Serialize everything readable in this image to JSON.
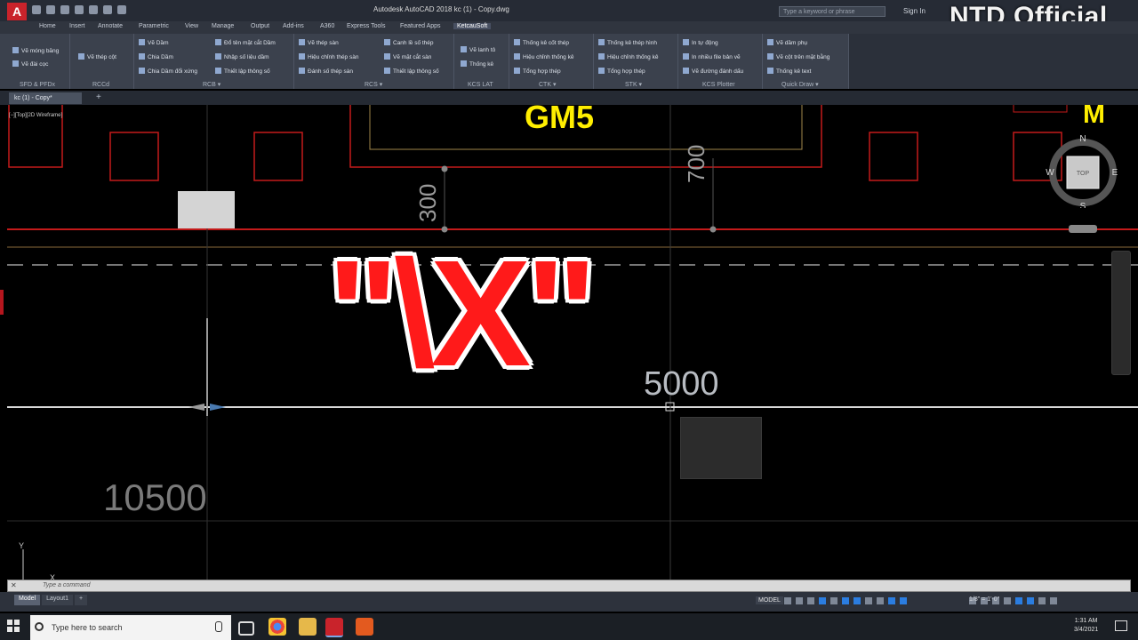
{
  "titlebar": {
    "app_letter": "A",
    "window_title": "Autodesk AutoCAD 2018    kc (1) - Copy.dwg",
    "search_placeholder": "Type a keyword or phrase",
    "signin": "Sign In",
    "watermark": "NTD Official"
  },
  "ribbon_tabs": [
    "Home",
    "Insert",
    "Annotate",
    "Parametric",
    "View",
    "Manage",
    "Output",
    "Add-ins",
    "A360",
    "Express Tools",
    "Featured Apps",
    "KetcauSoft"
  ],
  "ribbon_active_tab": "KetcauSoft",
  "ribbon": {
    "panels": [
      {
        "label": "SFD & PFDx",
        "items": [
          "Vẽ móng băng",
          "Vẽ đài cọc"
        ]
      },
      {
        "label": "RCCd",
        "items": [
          "Vẽ thép cột"
        ]
      },
      {
        "label": "RCB ▾",
        "items": [
          "Vẽ Dầm",
          "Chia Dầm",
          "Chia Dầm đổi xứng",
          "Đổ tên mặt cắt Dầm",
          "Nhập số liệu dầm",
          "Thiết lập thông số"
        ]
      },
      {
        "label": "RCS ▾",
        "items": [
          "Vẽ thép sàn",
          "Hiệu chỉnh thép sàn",
          "Đánh số thép sàn",
          "Canh lề số thép",
          "Vẽ mặt cắt sàn",
          "Thiết lập thông số"
        ]
      },
      {
        "label": "KCS LAT",
        "items": [
          "Vẽ lanh tô",
          "Thống kê"
        ]
      },
      {
        "label": "CTK ▾",
        "items": [
          "Thống kê cốt thép",
          "Hiệu chỉnh thống kê",
          "Tổng hợp thép"
        ]
      },
      {
        "label": "STK ▾",
        "items": [
          "Thống kê thép hình",
          "Hiệu chỉnh thống kê",
          "Tổng hợp thép"
        ]
      },
      {
        "label": "KCS Plotter",
        "items": [
          "In tự động",
          "In nhiều file bản vẽ",
          "Vẽ đường đánh dấu"
        ]
      },
      {
        "label": "Quick Draw ▾",
        "items": [
          "Vẽ dầm phụ",
          "Vẽ cột trên mặt bằng",
          "Thống kê text"
        ]
      }
    ]
  },
  "document": {
    "tab_label": "kc (1) - Copy*",
    "tab_plus": "+",
    "viewport_label": "[−][Top][2D Wireframe]"
  },
  "drawing": {
    "label_gm5": "GM5",
    "label_m": "M",
    "dim_300": "300",
    "dim_700": "700",
    "dim_5000": "5000",
    "dim_10500": "10500",
    "ucs_y": "Y",
    "ucs_x": "X"
  },
  "overlay_text": "\"\\X\"",
  "viewcube": {
    "north": "N",
    "south": "S",
    "east": "E",
    "west": "W",
    "face": "TOP"
  },
  "command_line": {
    "placeholder": "Type a command"
  },
  "statusbar": {
    "layout_tabs": [
      "Model",
      "Layout1",
      "+"
    ],
    "model_label": "MODEL",
    "scale": "1/8\" = 1'-0\""
  },
  "taskbar": {
    "search_placeholder": "Type here to search",
    "time": "1:31 AM",
    "date": "3/4/2021"
  },
  "colors": {
    "overlay_red": "#ff1a1a",
    "dimension_grey": "#b8bcc2",
    "label_yellow": "#ffee00",
    "column_red": "#c41a1a"
  }
}
